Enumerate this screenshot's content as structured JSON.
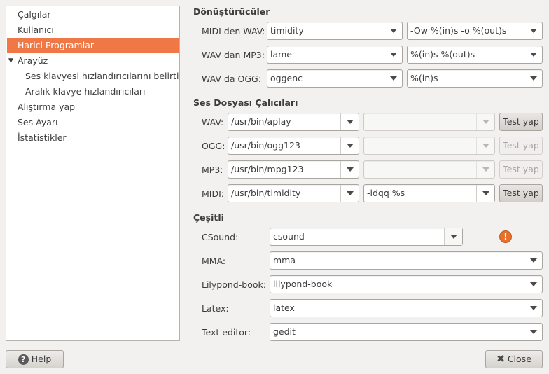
{
  "sidebar": {
    "items": [
      {
        "label": "Çalgılar"
      },
      {
        "label": "Kullanıcı"
      },
      {
        "label": "Harici Programlar",
        "selected": true
      },
      {
        "label": "Arayüz",
        "expanded": true
      },
      {
        "label": "Ses klavyesi hızlandırıcılarını belirtin"
      },
      {
        "label": "Aralık klavye hızlandırıcıları"
      },
      {
        "label": "Alıştırma yap"
      },
      {
        "label": "Ses Ayarı"
      },
      {
        "label": "İstatistikler"
      }
    ]
  },
  "converters": {
    "title": "Dönüştürücüler",
    "rows": [
      {
        "label": "MIDI den WAV:",
        "program": "timidity",
        "args": "-Ow %(in)s -o %(out)s"
      },
      {
        "label": "WAV dan MP3:",
        "program": "lame",
        "args": "%(in)s %(out)s"
      },
      {
        "label": "WAV da OGG:",
        "program": "oggenc",
        "args": "%(in)s"
      }
    ]
  },
  "players": {
    "title": "Ses Dosyası Çalıcıları",
    "test_label": "Test yap",
    "rows": [
      {
        "label": "WAV:",
        "program": "/usr/bin/aplay",
        "args": "",
        "test_enabled": true
      },
      {
        "label": "OGG:",
        "program": "/usr/bin/ogg123",
        "args": "",
        "test_enabled": false
      },
      {
        "label": "MP3:",
        "program": "/usr/bin/mpg123",
        "args": "",
        "test_enabled": false
      },
      {
        "label": "MIDI:",
        "program": "/usr/bin/timidity",
        "args": "-idqq %s",
        "test_enabled": true
      }
    ]
  },
  "misc": {
    "title": "Çeşitli",
    "rows": [
      {
        "label": "CSound:",
        "value": "csound"
      },
      {
        "label": "MMA:",
        "value": "mma"
      },
      {
        "label": "Lilypond-book:",
        "value": "lilypond-book"
      },
      {
        "label": "Latex:",
        "value": "latex"
      },
      {
        "label": "Text editor:",
        "value": "gedit"
      }
    ],
    "warning_icon": "!"
  },
  "footer": {
    "help_label": "Help",
    "close_label": "Close"
  },
  "colors": {
    "selection": "#f07746",
    "warning": "#e8702a"
  }
}
